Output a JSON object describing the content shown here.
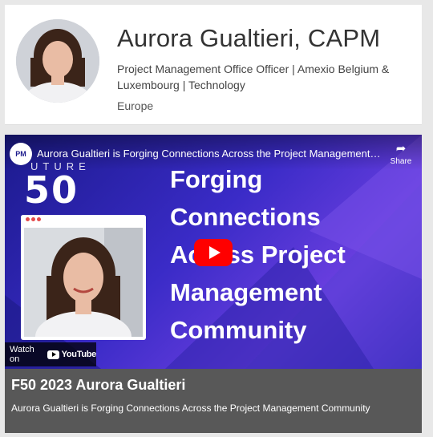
{
  "profile": {
    "name": "Aurora Gualtieri, CAPM",
    "title": "Project Management Office Officer | Amexio Belgium & Luxembourg | Technology",
    "location": "Europe"
  },
  "video": {
    "channel_logo_text": "PM",
    "heading": "Aurora Gualtieri is Forging Connections Across the Project Management Com...",
    "share_label": "Share",
    "future_text": "UTURE",
    "logo_number": "50",
    "headline_lines": [
      "Forging",
      "Connections",
      "Across Project",
      "Management",
      "Community"
    ],
    "watch_on_label": "Watch on",
    "youtube_wordmark": "YouTube",
    "caption_title": "F50 2023 Aurora Gualtieri",
    "caption_subtitle": "Aurora Gualtieri is Forging Connections Across the Project Management Community"
  },
  "colors": {
    "accent_red": "#ff0000",
    "video_bg": "#3a2bc7",
    "caption_bg": "#585858"
  },
  "icons": {
    "share": "share-arrow-icon",
    "play": "play-icon",
    "youtube": "youtube-logo-icon"
  }
}
